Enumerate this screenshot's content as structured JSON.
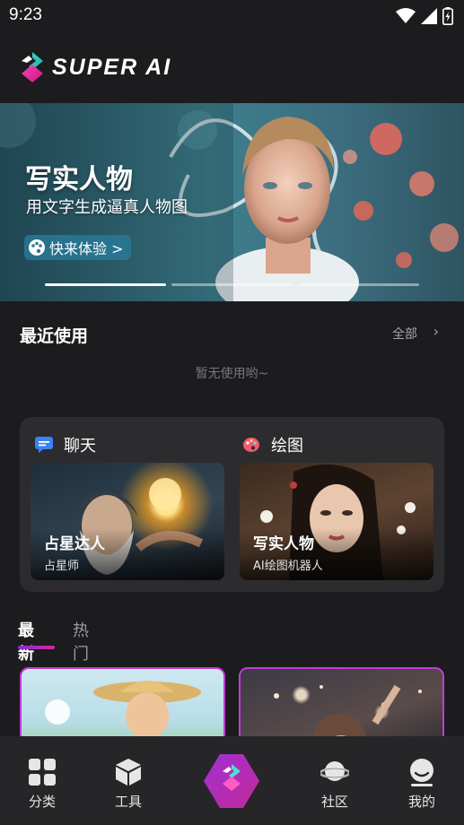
{
  "status_bar": {
    "time": "9:23",
    "icons": [
      "wifi-icon",
      "signal-icon",
      "battery-icon"
    ]
  },
  "header": {
    "logo_text": "SUPER AI",
    "logo_icon": "super-ai-logo-icon"
  },
  "banner": {
    "title": "写实人物",
    "subtitle": "用文字生成逼真人物图",
    "cta_label": "快来体验 >",
    "cta_icon": "palette-icon",
    "slides_count": 3,
    "active_slide": 1
  },
  "recent": {
    "title": "最近使用",
    "all_label": "全部",
    "empty_text": "暂无使用哟~"
  },
  "categories": {
    "chat": {
      "label": "聊天",
      "icon": "chat-bubble-icon",
      "card_title": "占星达人",
      "card_subtitle": "占星师"
    },
    "draw": {
      "label": "绘图",
      "icon": "palette-icon",
      "card_title": "写实人物",
      "card_subtitle": "AI绘图机器人"
    }
  },
  "feed": {
    "tabs": [
      {
        "label": "最新",
        "active": true
      },
      {
        "label": "热门",
        "active": false
      }
    ]
  },
  "tab_bar": {
    "items": [
      {
        "label": "分类",
        "icon": "grid-icon"
      },
      {
        "label": "工具",
        "icon": "cube-icon"
      },
      {
        "label": "",
        "icon": "super-ai-center-icon"
      },
      {
        "label": "社区",
        "icon": "planet-icon"
      },
      {
        "label": "我的",
        "icon": "profile-face-icon"
      }
    ]
  },
  "colors": {
    "background": "#1c1c1e",
    "card": "#2c2c2f",
    "accent_gradient_start": "#8a2bd6",
    "accent_gradient_end": "#d12a9c",
    "muted_text": "#9b9ba0"
  }
}
